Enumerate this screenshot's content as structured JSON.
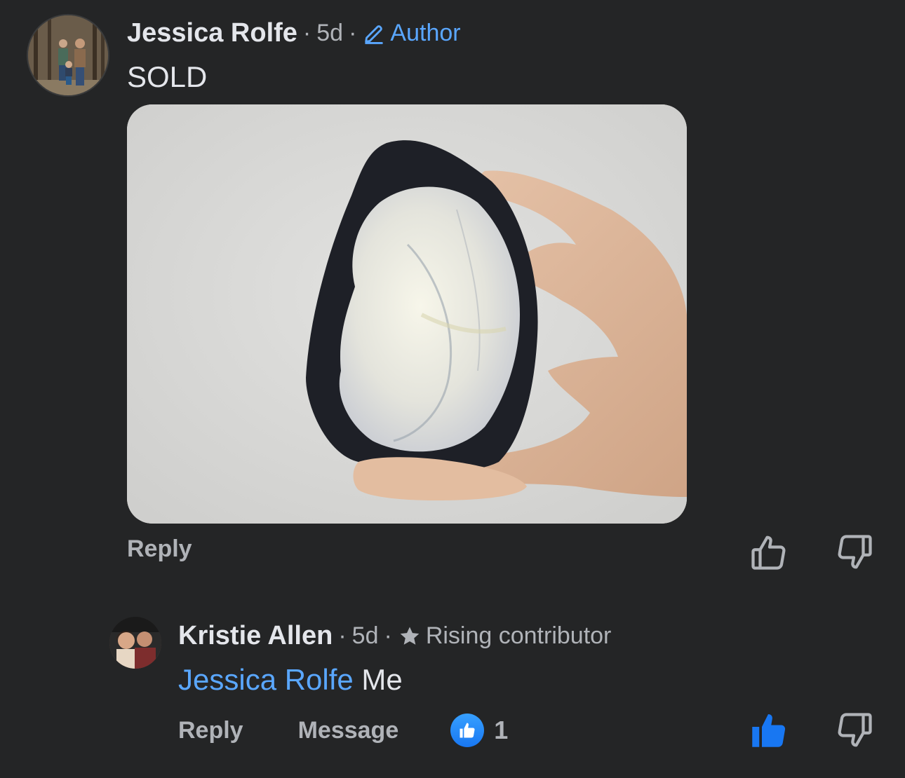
{
  "comments": [
    {
      "author": "Jessica Rolfe",
      "time": "5d",
      "badge": "Author",
      "text": "SOLD",
      "has_photo": true,
      "actions": {
        "reply": "Reply"
      }
    },
    {
      "author": "Kristie Allen",
      "time": "5d",
      "badge": "Rising contributor",
      "mention": "Jessica Rolfe",
      "text": " Me",
      "actions": {
        "reply": "Reply",
        "message": "Message"
      },
      "like_count": "1"
    }
  ],
  "separator": "·",
  "colors": {
    "background": "#242526",
    "text_primary": "#e4e6eb",
    "text_secondary": "#b0b3b8",
    "link_blue": "#5aa7ff",
    "like_blue": "#1877f2"
  },
  "icons": {
    "author_badge": "pencil-icon",
    "rising_badge": "star-icon",
    "like": "thumbs-up-icon",
    "dislike": "thumbs-down-icon"
  }
}
